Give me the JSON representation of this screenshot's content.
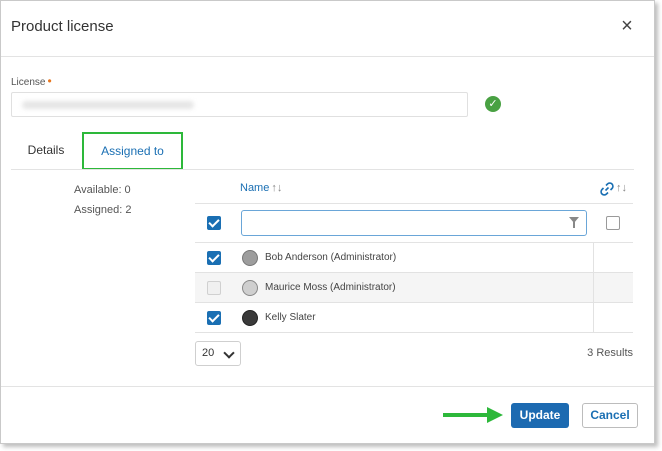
{
  "dialog": {
    "title": "Product license",
    "close_glyph": "×"
  },
  "license": {
    "label": "License",
    "required_marker": "•",
    "value_redacted": true,
    "status_icon": "check-circle-icon",
    "status_color": "#49a143"
  },
  "tabs": [
    {
      "label": "Details",
      "active": false
    },
    {
      "label": "Assigned to",
      "active": true,
      "highlight_color": "#2db83a"
    }
  ],
  "summary": {
    "available": "Available: 0",
    "assigned": "Assigned: 2"
  },
  "table": {
    "column_name": "Name",
    "sort_glyph": "↑↓",
    "link_icon": "link-icon",
    "filter_placeholder": "",
    "filter_icon": "funnel-icon",
    "select_all_checked": true,
    "assigned_only_checked": false,
    "rows": [
      {
        "name": "Bob Anderson  (Administrator)",
        "checked": true,
        "disabled": false
      },
      {
        "name": "Maurice Moss  (Administrator)",
        "checked": false,
        "disabled": true
      },
      {
        "name": "Kelly Slater",
        "checked": true,
        "disabled": false
      }
    ]
  },
  "pagination": {
    "page_size": "20",
    "results": "3 Results"
  },
  "footer": {
    "update_label": "Update",
    "cancel_label": "Cancel",
    "accent_color": "#1c6ab1",
    "arrow_color": "#2db83a"
  }
}
